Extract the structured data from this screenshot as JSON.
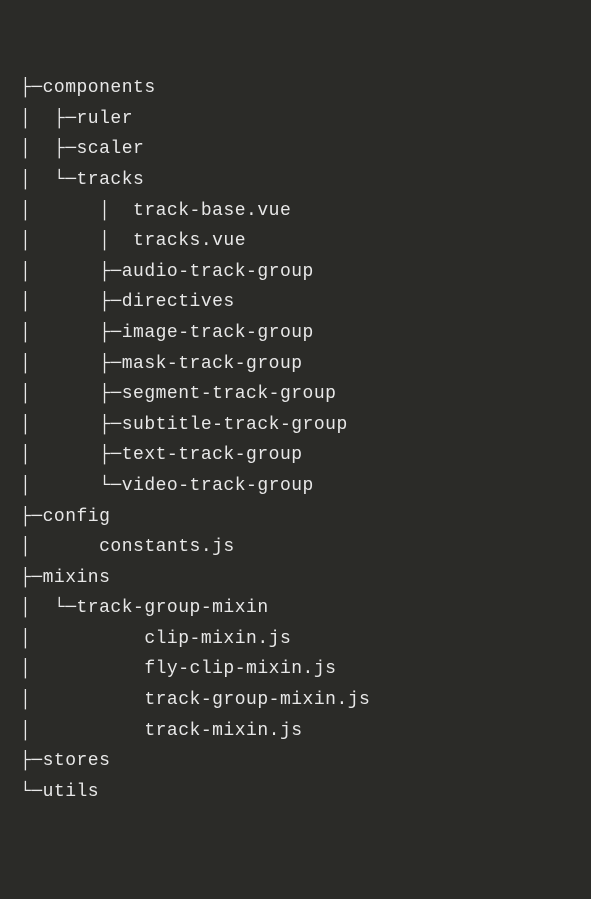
{
  "tree": {
    "l0": "├─components",
    "l1": "│  ├─ruler",
    "l2": "│  ├─scaler",
    "l3": "│  └─tracks",
    "l4": "│      │  track-base.vue",
    "l5": "│      │  tracks.vue",
    "l6": "│      ├─audio-track-group",
    "l7": "│      ├─directives",
    "l8": "│      ├─image-track-group",
    "l9": "│      ├─mask-track-group",
    "l10": "│      ├─segment-track-group",
    "l11": "│      ├─subtitle-track-group",
    "l12": "│      ├─text-track-group",
    "l13": "│      └─video-track-group",
    "l14": "├─config",
    "l15": "│      constants.js",
    "l16": "├─mixins",
    "l17": "│  └─track-group-mixin",
    "l18": "│          clip-mixin.js",
    "l19": "│          fly-clip-mixin.js",
    "l20": "│          track-group-mixin.js",
    "l21": "│          track-mixin.js",
    "l22": "├─stores",
    "l23": "└─utils"
  }
}
